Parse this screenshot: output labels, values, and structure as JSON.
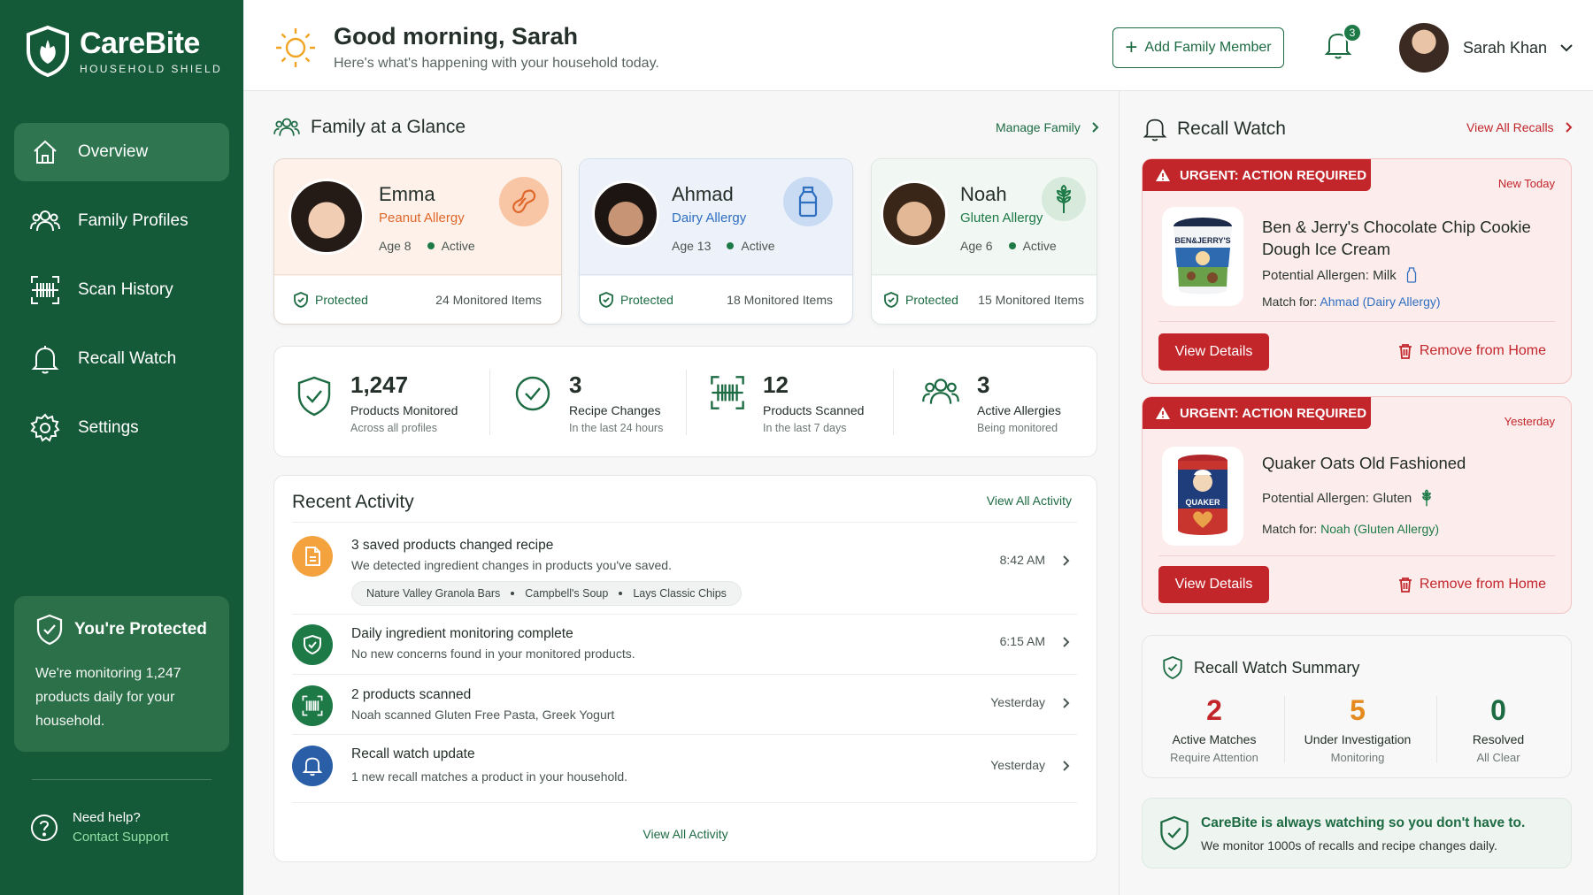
{
  "brand": {
    "name": "CareBite",
    "sub": "HOUSEHOLD SHIELD"
  },
  "nav": [
    {
      "label": "Overview",
      "icon": "home-icon"
    },
    {
      "label": "Family Profiles",
      "icon": "users-icon"
    },
    {
      "label": "Scan History",
      "icon": "barcode-icon"
    },
    {
      "label": "Recall Watch",
      "icon": "bell-icon"
    },
    {
      "label": "Settings",
      "icon": "gear-icon"
    }
  ],
  "protect_card": {
    "title": "You're Protected",
    "body": "We're monitoring 1,247 products daily for your household."
  },
  "help": {
    "q": "Need help?",
    "link": "Contact Support"
  },
  "header": {
    "greeting": "Good morning, Sarah",
    "subtitle": "Here's what's happening with your household today.",
    "add_button": "Add Family Member",
    "notif_count": "3",
    "user_name": "Sarah Khan"
  },
  "family": {
    "title": "Family at a Glance",
    "manage": "Manage Family",
    "members": [
      {
        "name": "Emma",
        "allergy": "Peanut Allergy",
        "age": "Age 8",
        "status": "Active",
        "protected": "Protected",
        "monitored": "24 Monitored Items",
        "accent": "#e0672a"
      },
      {
        "name": "Ahmad",
        "allergy": "Dairy Allergy",
        "age": "Age 13",
        "status": "Active",
        "protected": "Protected",
        "monitored": "18 Monitored Items",
        "accent": "#2f6fc0"
      },
      {
        "name": "Noah",
        "allergy": "Gluten Allergy",
        "age": "Age 6",
        "status": "Active",
        "protected": "Protected",
        "monitored": "15 Monitored Items",
        "accent": "#1d7a47"
      }
    ]
  },
  "stats": [
    {
      "num": "1,247",
      "label": "Products Monitored",
      "sub": "Across all profiles"
    },
    {
      "num": "3",
      "label": "Recipe Changes",
      "sub": "In the last 24 hours"
    },
    {
      "num": "12",
      "label": "Products Scanned",
      "sub": "In the last 7 days"
    },
    {
      "num": "3",
      "label": "Active Allergies",
      "sub": "Being monitored"
    }
  ],
  "activity": {
    "title": "Recent Activity",
    "view_all": "View All Activity",
    "items": [
      {
        "title": "3 saved products changed recipe",
        "desc": "We detected ingredient changes in products you've saved.",
        "time": "8:42 AM",
        "chips": [
          "Nature Valley Granola Bars",
          "Campbell's Soup",
          "Lays Classic Chips"
        ]
      },
      {
        "title": "Daily ingredient monitoring complete",
        "desc": "No new concerns found in your monitored products.",
        "time": "6:15 AM"
      },
      {
        "title": "2 products scanned",
        "desc": "Noah scanned Gluten Free Pasta, Greek Yogurt",
        "time": "Yesterday"
      },
      {
        "title": "Recall watch update",
        "desc": "1 new recall matches a product in your household.",
        "time": "Yesterday"
      }
    ],
    "view_all_bottom": "View All Activity"
  },
  "recall": {
    "title": "Recall Watch",
    "view_all": "View All Recalls",
    "items": [
      {
        "banner": "URGENT: ACTION REQUIRED",
        "when": "New Today",
        "product": "Ben & Jerry's Chocolate Chip Cookie Dough Ice Cream",
        "allergen": "Potential Allergen: Milk",
        "match_label": "Match for:",
        "match": "Ahmad (Dairy Allergy)",
        "details": "View Details",
        "remove": "Remove from Home",
        "pack_label": "BEN&JERRY'S"
      },
      {
        "banner": "URGENT: ACTION REQUIRED",
        "when": "Yesterday",
        "product": "Quaker Oats Old Fashioned",
        "allergen": "Potential Allergen: Gluten",
        "match_label": "Match for:",
        "match": "Noah (Gluten Allergy)",
        "details": "View Details",
        "remove": "Remove from Home",
        "pack_label": "QUAKER"
      }
    ]
  },
  "summary": {
    "title": "Recall Watch Summary",
    "cols": [
      {
        "n": "2",
        "label": "Active Matches",
        "sub": "Require Attention",
        "color": "#c2262b"
      },
      {
        "n": "5",
        "label": "Under Investigation",
        "sub": "Monitoring",
        "color": "#e58a1f"
      },
      {
        "n": "0",
        "label": "Resolved",
        "sub": "All Clear",
        "color": "#1d6b43"
      }
    ]
  },
  "watching": {
    "t1": "CareBite is always watching so you don't have to.",
    "t2": "We monitor 1000s of recalls and recipe changes daily."
  }
}
